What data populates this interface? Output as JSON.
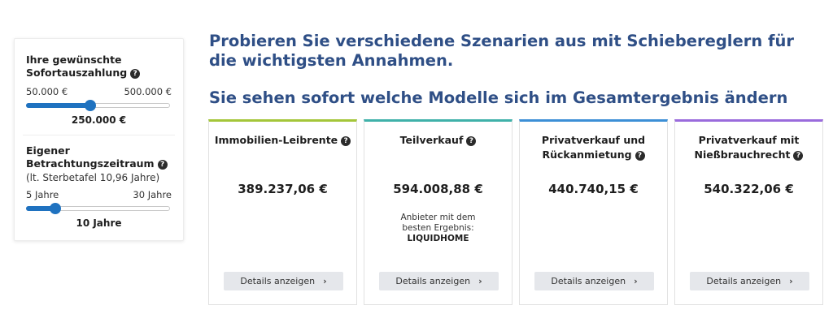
{
  "sidebar": {
    "payout": {
      "title": "Ihre gewünschte Sofortauszahlung",
      "min_label": "50.000 €",
      "max_label": "500.000 €",
      "value_label": "250.000 €",
      "fraction": 0.444
    },
    "period": {
      "title": "Eigener Betrachtungszeitraum",
      "subtitle": "(lt. Sterbetafel 10,96 Jahre)",
      "min_label": "5 Jahre",
      "max_label": "30 Jahre",
      "value_label": "10 Jahre",
      "fraction": 0.2
    }
  },
  "headline1": "Probieren Sie verschiedene Szenarien aus mit Schiebereglern für die wichtigsten Annahmen.",
  "headline2": "Sie sehen sofort welche Modelle sich im Gesamtergebnis ändern",
  "cards": [
    {
      "title": "Immobilien-Leibrente",
      "value": "389.237,06 €",
      "button": "Details anzeigen",
      "accent": "#a4c639"
    },
    {
      "title": "Teilverkauf",
      "value": "594.008,88 €",
      "note": "Anbieter mit dem besten Ergebnis:",
      "note_strong": "LIQUIDHOME",
      "button": "Details anzeigen",
      "accent": "#3fb1a9"
    },
    {
      "title": "Privatverkauf und Rückanmietung",
      "value": "440.740,15 €",
      "button": "Details anzeigen",
      "accent": "#3c8fd6"
    },
    {
      "title": "Privatverkauf mit Nießbrauchrecht",
      "value": "540.322,06 €",
      "button": "Details anzeigen",
      "accent": "#9a6bdc"
    }
  ],
  "icons": {
    "help": "help-icon",
    "chevron": "chevron-right-icon"
  },
  "colors": {
    "slider": "#1f72c0",
    "headline": "#2f4f86"
  }
}
